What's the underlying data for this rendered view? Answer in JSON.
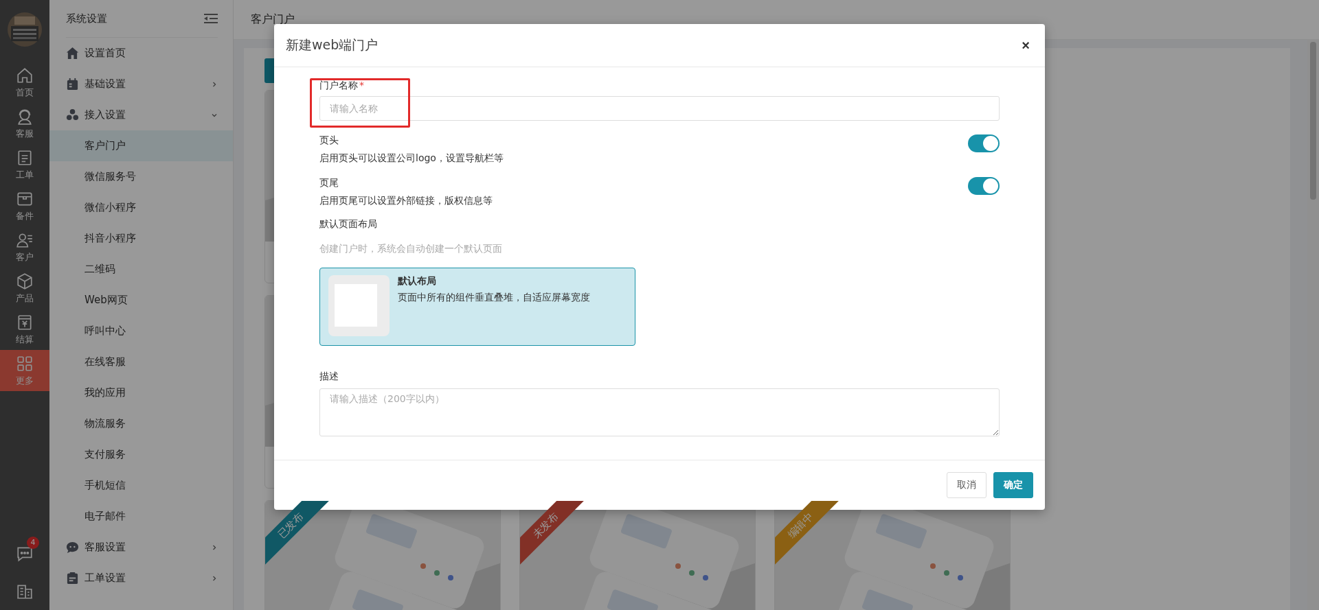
{
  "nav": [
    {
      "label": "首页",
      "selected": false
    },
    {
      "label": "客服",
      "selected": false
    },
    {
      "label": "工单",
      "selected": false
    },
    {
      "label": "备件",
      "selected": false
    },
    {
      "label": "客户",
      "selected": false
    },
    {
      "label": "产品",
      "selected": false
    },
    {
      "label": "结算",
      "selected": false
    },
    {
      "label": "更多",
      "selected": true
    }
  ],
  "nav_badge": "4",
  "sidebar": {
    "title": "系统设置",
    "items": [
      {
        "label": "设置首页"
      },
      {
        "label": "基础设置",
        "expanded": false
      },
      {
        "label": "接入设置",
        "expanded": true,
        "children": [
          {
            "label": "客户门户",
            "selected": true
          },
          {
            "label": "微信服务号",
            "selected": false
          },
          {
            "label": "微信小程序",
            "selected": false
          },
          {
            "label": "抖音小程序",
            "selected": false
          },
          {
            "label": "二维码",
            "selected": false
          },
          {
            "label": "Web网页",
            "selected": false
          },
          {
            "label": "呼叫中心",
            "selected": false
          },
          {
            "label": "在线客服",
            "selected": false
          },
          {
            "label": "我的应用",
            "selected": false
          },
          {
            "label": "物流服务",
            "selected": false
          },
          {
            "label": "支付服务",
            "selected": false
          },
          {
            "label": "手机短信",
            "selected": false
          },
          {
            "label": "电子邮件",
            "selected": false
          }
        ]
      },
      {
        "label": "客服设置",
        "expanded": false
      },
      {
        "label": "工单设置",
        "expanded": false
      }
    ]
  },
  "page_title": "客户门户",
  "cards": [
    {
      "ribbon": "已发布",
      "color": "#105865"
    },
    {
      "ribbon": "未发布",
      "color": "#823026"
    },
    {
      "ribbon": "编辑中",
      "color": "#8b6013"
    }
  ],
  "dialog": {
    "title": "新建web端门户",
    "close": "×",
    "name_label": "门户名称",
    "required_mark": "*",
    "name_placeholder": "请输入名称",
    "toggles": [
      {
        "label": "页头",
        "desc": "启用页头可以设置公司logo，设置导航栏等",
        "on": true
      },
      {
        "label": "页尾",
        "desc": "启用页尾可以设置外部链接，版权信息等",
        "on": true
      }
    ],
    "layout_label": "默认页面布局",
    "layout_hint": "创建门户时，系统会自动创建一个默认页面",
    "layouts": [
      {
        "title": "默认布局",
        "desc": "页面中所有的组件垂直叠堆，自适应屏幕宽度",
        "selected": true
      }
    ],
    "desc_label": "描述",
    "desc_placeholder": "请输入描述（200字以内）",
    "buttons": [
      {
        "label": "取消",
        "kind": "secondary"
      },
      {
        "label": "确定",
        "kind": "primary"
      }
    ]
  }
}
